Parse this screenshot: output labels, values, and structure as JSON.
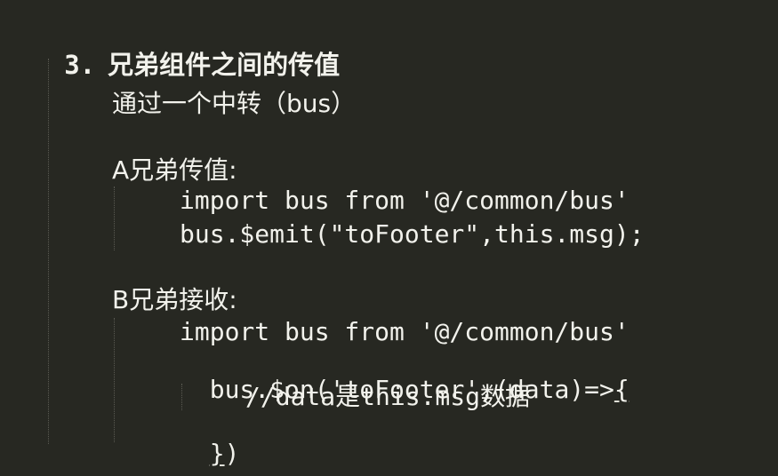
{
  "heading": {
    "number": "3.",
    "title": "兄弟组件之间的传值"
  },
  "intro": "通过一个中转（bus）",
  "section_a": {
    "label": "A兄弟传值:",
    "code": [
      "import bus from '@/common/bus'",
      "bus.$emit(\"toFooter\",this.msg);"
    ]
  },
  "section_b": {
    "label": "B兄弟接收:",
    "code_import": "import bus from '@/common/bus'",
    "code_on_prefix": "bus.$on('toFooter',(data)=>",
    "code_on_brace": "{",
    "code_comment": "//data是this.msg数据",
    "code_close_brace": "}",
    "code_close_paren": ")"
  }
}
